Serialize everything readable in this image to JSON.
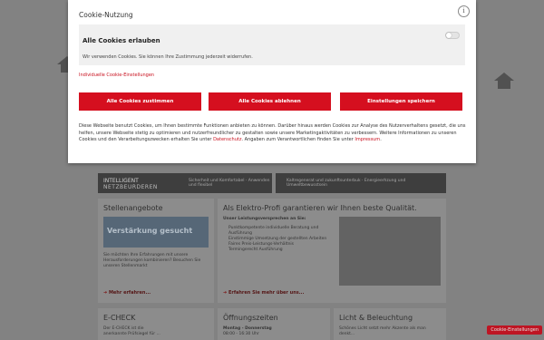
{
  "cookie": {
    "title": "Cookie-Nutzung",
    "info_icon": "i",
    "section_title": "Alle Cookies erlauben",
    "section_text": "Wir verwenden Cookies. Sie können Ihre Zustimmung jederzeit widerrufen.",
    "individual_link": "Individuelle Cookie-Einstellungen",
    "buttons": {
      "accept_all": "Alle Cookies zustimmen",
      "reject_all": "Alle Cookies ablehnen",
      "save": "Einstellungen speichern"
    },
    "notice_1": "Diese Webseite benutzt Cookies, um Ihnen bestimmte Funktionen anbieten zu können. Darüber hinaus werden Cookies zur Analyse des Nutzerverhaltens gesetzt, die uns helfen, unsere Webseite stetig zu optimieren und nutzerfreundlicher zu gestalten sowie unsere Marketingaktivitäten zu verbessern. Weitere Informationen zu unseren Cookies und den Verarbeitungszwecken erhalten Sie unter ",
    "datenschutz": "Datenschutz",
    "notice_2": ". Angaben zum Verantwortlichen finden Sie unter ",
    "impressum": "Impressum",
    "notice_3": "."
  },
  "background": {
    "bar1": {
      "title": "INTELLIGENT",
      "subtitle": "NETZBEURDEREN",
      "desc": "Sicherheit und Komfortabel · Anwenden und flexibel"
    },
    "bar2": {
      "desc": "Kaltregenerat und zukunftsunterbuk · Energieerhzung und Umweltbewusstsein"
    },
    "stellen": {
      "title": "Stellenangebote",
      "banner": "Verstärkung gesucht",
      "text": "Sie möchten Ihre Erfahrungen mit unsere Herausforderungen kombinieren? Besuchen Sie unseren Stellenmarkt",
      "more": "Mehr erfahren..."
    },
    "profi": {
      "title": "Als Elektro-Profi garantieren wir Ihnen beste Qualität.",
      "subtitle": "Unser Leistungsversprechen an Sie:",
      "bullets": [
        "Punktkompetente individuelle Beratung und Ausführung",
        "Einstimmige Umsetzung der gestellten Arbeiten",
        "Faires Preis-Leistungs-Verhältnis",
        "Termingerecht Ausführung"
      ],
      "more": "Erfahren Sie mehr über uns..."
    },
    "echeck": {
      "title": "E-CHECK",
      "text": "Der E-CHECK ist die anerkannte Prüfsiegel für ..."
    },
    "oeffnung": {
      "title": "Öffnungszeiten",
      "line1": "Montag - Donnerstag",
      "line2": "08:00 - 16:30 Uhr"
    },
    "licht": {
      "title": "Licht & Beleuchtung",
      "text": "Schönes Licht setzt mehr Akzente als man denkt..."
    },
    "cookie_tab": "Cookie-Einstellungen"
  },
  "colors": {
    "accent": "#d50f1f",
    "link": "#c8101e"
  }
}
